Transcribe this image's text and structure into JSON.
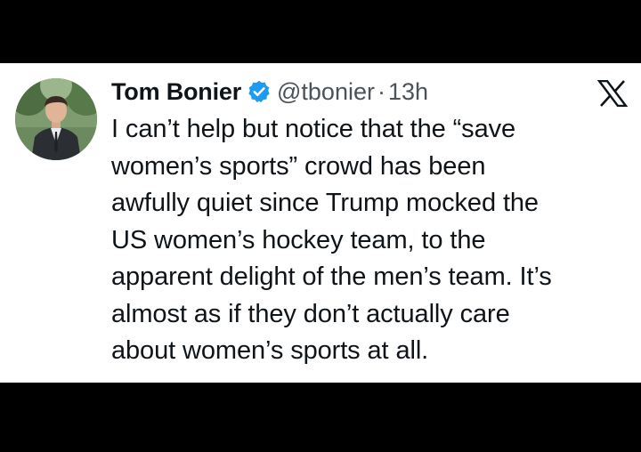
{
  "tweet": {
    "author_name": "Tom Bonier",
    "author_handle": "@tbonier",
    "separator": "·",
    "timestamp": "13h",
    "text_lines": [
      "I can’t help but notice that the “save",
      "women’s sports” crowd has been",
      "awfully quiet since Trump mocked the",
      "US women’s hockey team, to the",
      "apparent delight of the men’s team. It’s",
      "almost as if they don’t actually care",
      "about women’s sports at all."
    ]
  },
  "icons": {
    "verified": "verified-badge-icon",
    "platform": "x-logo-icon"
  },
  "colors": {
    "background_frame": "#000000",
    "card": "#ffffff",
    "text_primary": "#0f1419",
    "text_secondary": "#4b5259",
    "verified_blue": "#1d9bf0"
  }
}
